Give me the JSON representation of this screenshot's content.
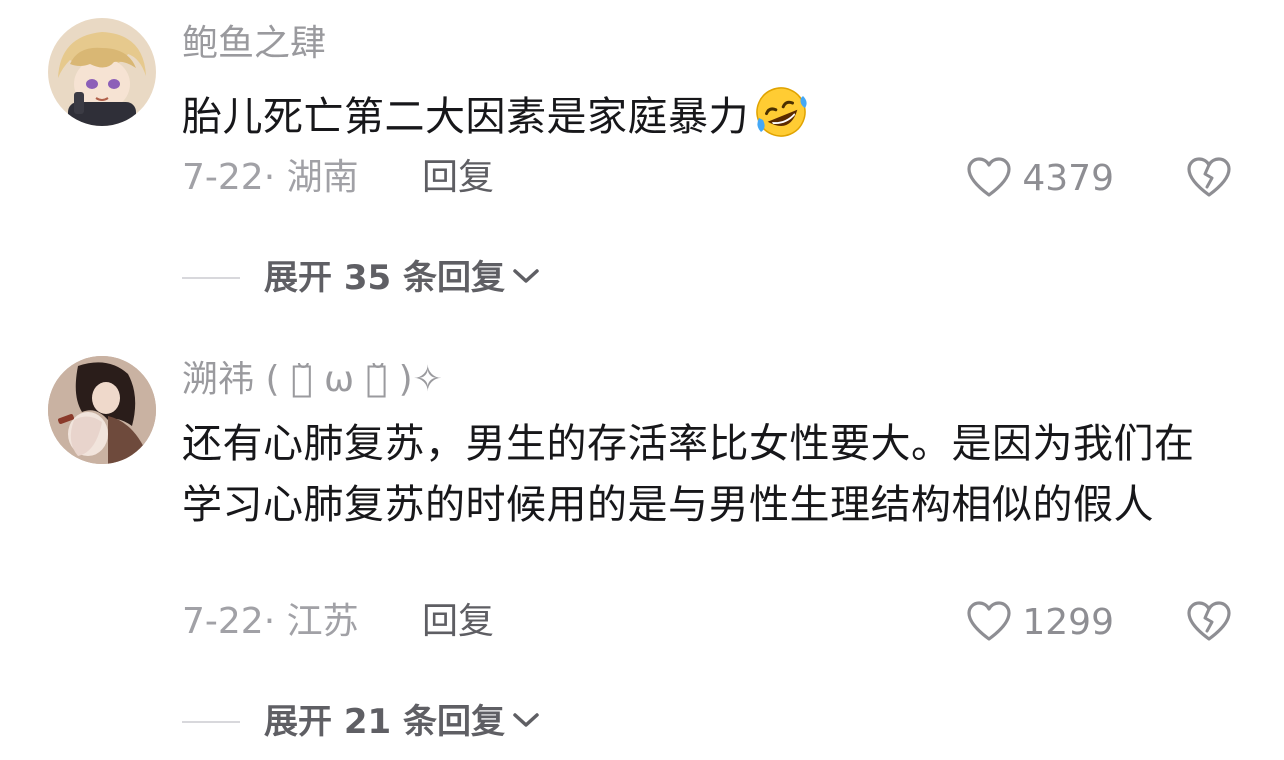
{
  "comments": [
    {
      "username": "鲍鱼之肆",
      "content": "胎儿死亡第二大因素是家庭暴力",
      "emoji_icon": "rofl-emoji-icon",
      "meta": "7-22· 湖南",
      "reply_label": "回复",
      "likes": "4379",
      "expand_label": "展开 35 条回复"
    },
    {
      "username": "溯祎 ( ･̆ ω ･̆ )✧",
      "content": "还有心肺复苏，男生的存活率比女性要大。是因为我们在学习心肺复苏的时候用的是与男性生理结构相似的假人",
      "meta": "7-22· 江苏",
      "reply_label": "回复",
      "likes": "1299",
      "expand_label": "展开 21 条回复"
    }
  ],
  "colors": {
    "username": "#9a9a9e",
    "content": "#17171a",
    "meta": "#a1a1a6",
    "reply": "#5e5e63",
    "expand": "#5f5f64"
  },
  "icons": {
    "like": "heart-outline-icon",
    "dislike": "broken-heart-icon",
    "expand": "chevron-down-icon"
  }
}
